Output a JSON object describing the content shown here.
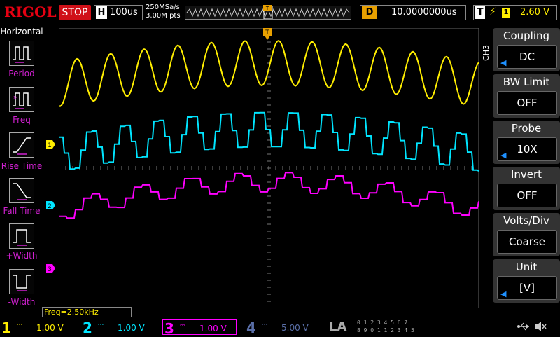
{
  "header": {
    "logo": "RIGOL",
    "run_state": "STOP",
    "horizontal_label": "H",
    "timebase": "100us",
    "sample_rate": "250MSa/s",
    "memory_depth": "3.00M pts",
    "delay_label": "D",
    "delay_value": "10.0000000us",
    "trigger_label": "T",
    "trigger_source": "1",
    "trigger_level": "2.60 V"
  },
  "left_menu": {
    "title": "Horizontal",
    "items": [
      {
        "label": "Period"
      },
      {
        "label": "Freq"
      },
      {
        "label": "Rise Time"
      },
      {
        "label": "Fall Time"
      },
      {
        "label": "+Width"
      },
      {
        "label": "-Width"
      }
    ]
  },
  "right_menu": {
    "channel_tag": "CH3",
    "items": [
      {
        "title": "Coupling",
        "value": "DC"
      },
      {
        "title": "BW Limit",
        "value": "OFF"
      },
      {
        "title": "Probe",
        "value": "10X"
      },
      {
        "title": "Invert",
        "value": "OFF"
      },
      {
        "title": "Volts/Div",
        "value": "Coarse"
      },
      {
        "title": "Unit",
        "value": "[V]"
      }
    ]
  },
  "measurement": {
    "freq": "Freq=2.50kHz"
  },
  "channel_markers": {
    "ch1": "1",
    "ch2": "2",
    "ch3": "3",
    "trigger": "T"
  },
  "bottom_bar": {
    "channels": [
      {
        "num": "1",
        "scale": "1.00 V",
        "color": "#ffee00"
      },
      {
        "num": "2",
        "scale": "1.00 V",
        "color": "#00e5ff"
      },
      {
        "num": "3",
        "scale": "1.00 V",
        "color": "#ff00ff"
      },
      {
        "num": "4",
        "scale": "5.00 V",
        "color": "#5a6fa8"
      }
    ],
    "la_label": "LA",
    "la_row1": "0 1 2 3 4 5 6 7",
    "la_row2": "8 9 0 1 1 2 3 4 5"
  },
  "colors": {
    "ch1": "#ffee00",
    "ch2": "#00e5ff",
    "ch3": "#ff00ff",
    "menu_label": "#d020d0",
    "stop": "#d01018",
    "delay": "#e8a000"
  },
  "icons": [
    "period-icon",
    "freq-icon",
    "rise-time-icon",
    "fall-time-icon",
    "pos-width-icon",
    "neg-width-icon",
    "usb-icon",
    "speaker-icon",
    "trigger-edge-icon"
  ]
}
